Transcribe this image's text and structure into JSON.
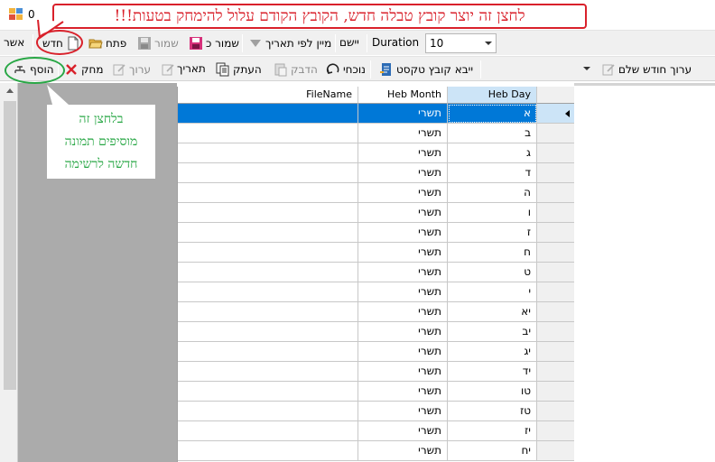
{
  "window": {
    "title": "0"
  },
  "callout": {
    "text": "לחצן זה יוצר קובץ טבלה חדש, הקובץ הקודם עלול להימחק בטעות!!!"
  },
  "note": {
    "lines": [
      "בלחצן זה",
      "מוסיפים תמונה",
      "חדשה לרשימה"
    ]
  },
  "toolbar1": {
    "asher": "אשר",
    "new": "חדש",
    "open": "פתח",
    "save": "שמור",
    "save_as": "שמור כ",
    "sort_by_date": "מיין לפי תאריך",
    "apply": "יישם",
    "duration_label": "Duration",
    "duration_value": "10"
  },
  "toolbar2": {
    "add": "הוסף",
    "delete": "מחק",
    "edit": "ערוך",
    "date": "תאריך",
    "copy": "העתק",
    "paste": "הדבק",
    "current": "נוכחי",
    "import_text": "ייבא קובץ טקסט",
    "edit_full_month": "ערוך חודש שלם"
  },
  "grid": {
    "columns": [
      "FileName",
      "Heb Month",
      "Heb Day"
    ],
    "rows": [
      {
        "file": "",
        "month": "תשרי",
        "day": "א"
      },
      {
        "file": "",
        "month": "תשרי",
        "day": "ב"
      },
      {
        "file": "",
        "month": "תשרי",
        "day": "ג"
      },
      {
        "file": "",
        "month": "תשרי",
        "day": "ד"
      },
      {
        "file": "",
        "month": "תשרי",
        "day": "ה"
      },
      {
        "file": "",
        "month": "תשרי",
        "day": "ו"
      },
      {
        "file": "",
        "month": "תשרי",
        "day": "ז"
      },
      {
        "file": "",
        "month": "תשרי",
        "day": "ח"
      },
      {
        "file": "",
        "month": "תשרי",
        "day": "ט"
      },
      {
        "file": "",
        "month": "תשרי",
        "day": "י"
      },
      {
        "file": "",
        "month": "תשרי",
        "day": "יא"
      },
      {
        "file": "",
        "month": "תשרי",
        "day": "יב"
      },
      {
        "file": "",
        "month": "תשרי",
        "day": "יג"
      },
      {
        "file": "",
        "month": "תשרי",
        "day": "יד"
      },
      {
        "file": "",
        "month": "תשרי",
        "day": "טו"
      },
      {
        "file": "",
        "month": "תשרי",
        "day": "טז"
      },
      {
        "file": "",
        "month": "תשרי",
        "day": "יז"
      },
      {
        "file": "",
        "month": "תשרי",
        "day": "יח"
      }
    ]
  },
  "colors": {
    "callout": "#d9212b",
    "note": "#28a745",
    "selection": "#0078d7"
  }
}
